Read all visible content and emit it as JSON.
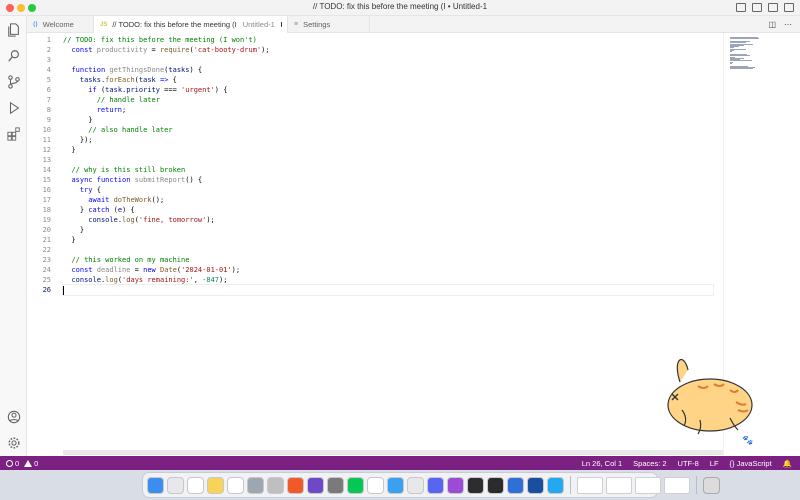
{
  "window": {
    "title": "// TODO: fix this before the meeting (I • Untitled-1"
  },
  "tabs": [
    {
      "icon": "",
      "label": "Welcome",
      "subtitle": "",
      "active": false
    },
    {
      "icon": "JS",
      "label": "// TODO: fix this before the meeting (I",
      "subtitle": "Untitled-1",
      "active": true,
      "unsaved": true
    },
    {
      "icon": "",
      "label": "Settings",
      "subtitle": "",
      "active": false
    }
  ],
  "editor": {
    "language_icon_color": "#cbcb41",
    "current_line": 26,
    "lines": [
      {
        "n": "1",
        "tokens": [
          [
            "cm",
            "// TODO: fix this before the meeting (I won't)"
          ]
        ]
      },
      {
        "n": "2",
        "tokens": [
          [
            "",
            "  "
          ],
          [
            "kw",
            "const"
          ],
          [
            "",
            " "
          ],
          [
            "dim",
            "productivity"
          ],
          [
            "",
            " = "
          ],
          [
            "fn",
            "require"
          ],
          [
            "",
            "("
          ],
          [
            "str",
            "'cat-booty-drum'"
          ],
          [
            "",
            ");"
          ]
        ]
      },
      {
        "n": "3",
        "tokens": []
      },
      {
        "n": "4",
        "tokens": [
          [
            "",
            "  "
          ],
          [
            "kw",
            "function"
          ],
          [
            "",
            " "
          ],
          [
            "dim",
            "getThingsDone"
          ],
          [
            "",
            "("
          ],
          [
            "var",
            "tasks"
          ],
          [
            "",
            ") {"
          ]
        ]
      },
      {
        "n": "5",
        "tokens": [
          [
            "",
            "    "
          ],
          [
            "var",
            "tasks"
          ],
          [
            "",
            "."
          ],
          [
            "fn",
            "forEach"
          ],
          [
            "",
            "("
          ],
          [
            "var",
            "task"
          ],
          [
            "",
            " "
          ],
          [
            "kw",
            "=>"
          ],
          [
            "",
            " {"
          ]
        ]
      },
      {
        "n": "6",
        "tokens": [
          [
            "",
            "      "
          ],
          [
            "kw",
            "if"
          ],
          [
            "",
            " ("
          ],
          [
            "var",
            "task"
          ],
          [
            "",
            "."
          ],
          [
            "var",
            "priority"
          ],
          [
            "",
            " === "
          ],
          [
            "str",
            "'urgent'"
          ],
          [
            "",
            ") {"
          ]
        ]
      },
      {
        "n": "7",
        "tokens": [
          [
            "",
            "        "
          ],
          [
            "cm",
            "// handle later"
          ]
        ]
      },
      {
        "n": "8",
        "tokens": [
          [
            "",
            "        "
          ],
          [
            "kw",
            "return"
          ],
          [
            "",
            ";"
          ]
        ]
      },
      {
        "n": "9",
        "tokens": [
          [
            "",
            "      }"
          ]
        ]
      },
      {
        "n": "10",
        "tokens": [
          [
            "",
            "      "
          ],
          [
            "cm",
            "// also handle later"
          ]
        ]
      },
      {
        "n": "11",
        "tokens": [
          [
            "",
            "    });"
          ]
        ]
      },
      {
        "n": "12",
        "tokens": [
          [
            "",
            "  }"
          ]
        ]
      },
      {
        "n": "13",
        "tokens": []
      },
      {
        "n": "14",
        "tokens": [
          [
            "",
            "  "
          ],
          [
            "cm",
            "// why is this still broken"
          ]
        ]
      },
      {
        "n": "15",
        "tokens": [
          [
            "",
            "  "
          ],
          [
            "kw",
            "async"
          ],
          [
            "",
            " "
          ],
          [
            "kw",
            "function"
          ],
          [
            "",
            " "
          ],
          [
            "dim",
            "submitReport"
          ],
          [
            "",
            "() {"
          ]
        ]
      },
      {
        "n": "16",
        "tokens": [
          [
            "",
            "    "
          ],
          [
            "kw",
            "try"
          ],
          [
            "",
            " {"
          ]
        ]
      },
      {
        "n": "17",
        "tokens": [
          [
            "",
            "      "
          ],
          [
            "kw",
            "await"
          ],
          [
            "",
            " "
          ],
          [
            "fn",
            "doTheWork"
          ],
          [
            "",
            "();"
          ]
        ]
      },
      {
        "n": "18",
        "tokens": [
          [
            "",
            "    } "
          ],
          [
            "kw",
            "catch"
          ],
          [
            "",
            " ("
          ],
          [
            "var",
            "e"
          ],
          [
            "",
            ") {"
          ]
        ]
      },
      {
        "n": "19",
        "tokens": [
          [
            "",
            "      "
          ],
          [
            "var",
            "console"
          ],
          [
            "",
            "."
          ],
          [
            "fn",
            "log"
          ],
          [
            "",
            "("
          ],
          [
            "str",
            "'fine, tomorrow'"
          ],
          [
            "",
            ");"
          ]
        ]
      },
      {
        "n": "20",
        "tokens": [
          [
            "",
            "    }"
          ]
        ]
      },
      {
        "n": "21",
        "tokens": [
          [
            "",
            "  }"
          ]
        ]
      },
      {
        "n": "22",
        "tokens": []
      },
      {
        "n": "23",
        "tokens": [
          [
            "",
            "  "
          ],
          [
            "cm",
            "// this worked on my machine"
          ]
        ]
      },
      {
        "n": "24",
        "tokens": [
          [
            "",
            "  "
          ],
          [
            "kw",
            "const"
          ],
          [
            "",
            " "
          ],
          [
            "dim",
            "deadline"
          ],
          [
            "",
            " = "
          ],
          [
            "kw",
            "new"
          ],
          [
            "",
            " "
          ],
          [
            "fn",
            "Date"
          ],
          [
            "",
            "("
          ],
          [
            "str",
            "'2024-01-01'"
          ],
          [
            "",
            ");"
          ]
        ]
      },
      {
        "n": "25",
        "tokens": [
          [
            "",
            "  "
          ],
          [
            "var",
            "console"
          ],
          [
            "",
            "."
          ],
          [
            "fn",
            "log"
          ],
          [
            "",
            "("
          ],
          [
            "str",
            "'days remaining:'"
          ],
          [
            "",
            ", "
          ],
          [
            "num",
            "-847"
          ],
          [
            "",
            ");"
          ]
        ]
      },
      {
        "n": "26",
        "tokens": []
      }
    ]
  },
  "statusbar": {
    "errors": "0",
    "warnings": "0",
    "position": "Ln 26, Col 1",
    "spaces": "Spaces: 2",
    "encoding": "UTF-8",
    "eol": "LF",
    "language": "{} JavaScript",
    "color": "#7b2182"
  },
  "activity_icons": [
    "files-icon",
    "search-icon",
    "source-control-icon",
    "run-debug-icon",
    "extensions-icon",
    "account-icon",
    "settings-gear-icon"
  ],
  "dock_apps": [
    {
      "name": "finder",
      "color": "#3b8df0"
    },
    {
      "name": "launchpad",
      "color": "#e7e7ec"
    },
    {
      "name": "calendar",
      "color": "#ffffff"
    },
    {
      "name": "notes",
      "color": "#f7d35a"
    },
    {
      "name": "notion",
      "color": "#ffffff"
    },
    {
      "name": "chrome-dev",
      "color": "#9da7b1"
    },
    {
      "name": "screen-share",
      "color": "#bfbfbf"
    },
    {
      "name": "brave",
      "color": "#f05a28"
    },
    {
      "name": "obsidian",
      "color": "#6e48c9"
    },
    {
      "name": "calculator",
      "color": "#7a7a7a"
    },
    {
      "name": "line",
      "color": "#06c755"
    },
    {
      "name": "ai-app",
      "color": "#ffffff"
    },
    {
      "name": "safari",
      "color": "#3aa0f2"
    },
    {
      "name": "chrome",
      "color": "#e8e8e8"
    },
    {
      "name": "discord",
      "color": "#5865f2"
    },
    {
      "name": "podcasts",
      "color": "#9b4bd6"
    },
    {
      "name": "cursor",
      "color": "#2d2d2d"
    },
    {
      "name": "terminal",
      "color": "#2b2b2b"
    },
    {
      "name": "app-store",
      "color": "#2f6fd6"
    },
    {
      "name": "vpn",
      "color": "#1a4fa0"
    },
    {
      "name": "vscode",
      "color": "#23a9f2"
    }
  ]
}
